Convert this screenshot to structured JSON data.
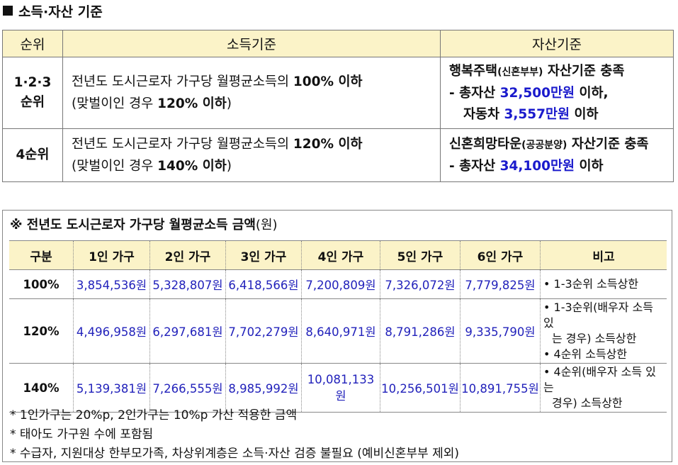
{
  "section_title": "소득·자산 기준",
  "table1": {
    "headers": [
      "순위",
      "소득기준",
      "자산기준"
    ],
    "rows": [
      {
        "rank_line1": "1·2·3",
        "rank_line2": "순위",
        "income_line1_pre": "전년도 도시근로자 가구당 월평균소득의 ",
        "income_line1_bold": "100% 이하",
        "income_line2_pre": "(맞벌이인 경우 ",
        "income_line2_bold": "120% 이하",
        "income_line2_post": ")",
        "asset_title": "행복주택",
        "asset_title_small": "(신혼부부)",
        "asset_title_post": " 자산기준 충족",
        "asset_l2_pre": "- 총자산 ",
        "asset_l2_val": "32,500만원",
        "asset_l2_post": " 이하,",
        "asset_l3_pre": "자동차 ",
        "asset_l3_val": "3,557만원",
        "asset_l3_post": " 이하"
      },
      {
        "rank_line1": "4순위",
        "income_line1_pre": "전년도 도시근로자 가구당 월평균소득의 ",
        "income_line1_bold": "120% 이하",
        "income_line2_pre": "(맞벌이인 경우 ",
        "income_line2_bold": "140% 이하",
        "income_line2_post": ")",
        "asset_title": "신혼희망타운",
        "asset_title_small": "(공공분양)",
        "asset_title_post": " 자산기준 충족",
        "asset_l2_pre": "- 총자산 ",
        "asset_l2_val": "34,100만원",
        "asset_l2_post": " 이하"
      }
    ]
  },
  "box": {
    "title_bold": "※ 전년도 도시근로자 가구당 월평균소득 금액",
    "title_unit": "(원)",
    "headers": [
      "구분",
      "1인 가구",
      "2인 가구",
      "3인 가구",
      "4인 가구",
      "5인 가구",
      "6인 가구",
      "비고"
    ],
    "rows": [
      {
        "level": "100%",
        "values": [
          "3,854,536원",
          "5,328,807원",
          "6,418,566원",
          "7,200,809원",
          "7,326,072원",
          "7,779,825원"
        ],
        "note1": "• 1-3순위 소득상한"
      },
      {
        "level": "120%",
        "values": [
          "4,496,958원",
          "6,297,681원",
          "7,702,279원",
          "8,640,971원",
          "8,791,286원",
          "9,335,790원"
        ],
        "note1": "• 1-3순위(배우자 소득 있",
        "note1b": "는 경우) 소득상한",
        "note2": "• 4순위 소득상한"
      },
      {
        "level": "140%",
        "values": [
          "5,139,381원",
          "7,266,555원",
          "8,985,992원",
          "10,081,133원",
          "10,256,501원",
          "10,891,755원"
        ],
        "note1": "• 4순위(배우자 소득 있는",
        "note1b": "경우) 소득상한"
      }
    ],
    "footnotes": [
      "* 1인가구는 20%p, 2인가구는 10%p 가산 적용한 금액",
      "* 태아도 가구원 수에 포함됨",
      "* 수급자, 지원대상 한부모가족, 차상위계층은 소득·자산 검증 불필요 (예비신혼부부 제외)"
    ]
  }
}
